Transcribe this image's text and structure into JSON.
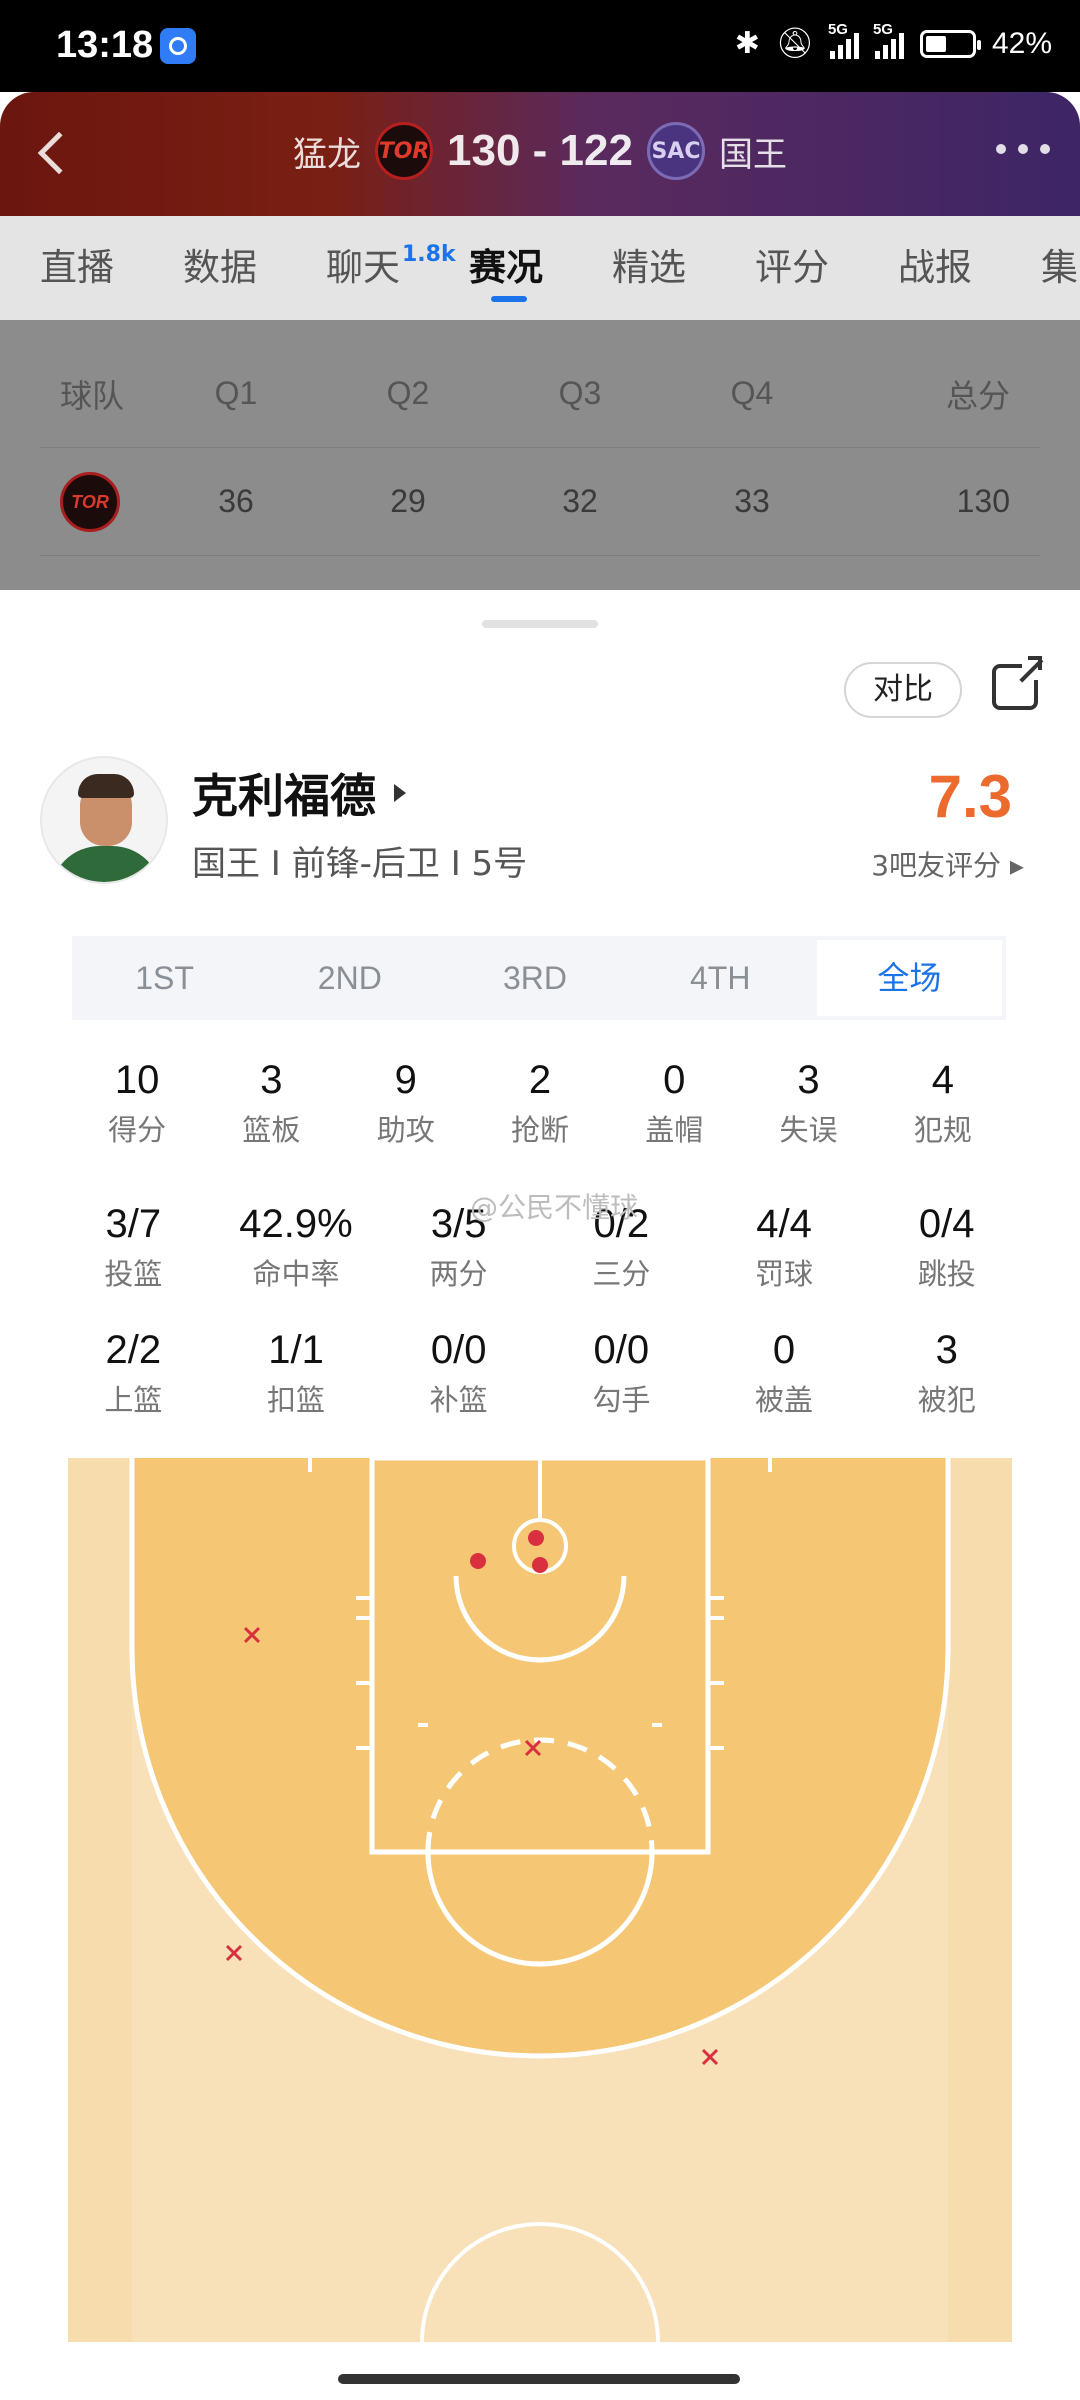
{
  "status_bar": {
    "time": "13:18",
    "signal1": "5G",
    "signal2": "5G",
    "battery": "42%"
  },
  "header": {
    "home_team": "猛龙",
    "home_abbr": "TOR",
    "score": "130 - 122",
    "away_abbr": "SAC",
    "away_team": "国王"
  },
  "tabs": [
    {
      "label": "直播"
    },
    {
      "label": "数据"
    },
    {
      "label": "聊天",
      "badge": "1.8k"
    },
    {
      "label": "赛况"
    },
    {
      "label": "精选"
    },
    {
      "label": "评分"
    },
    {
      "label": "战报"
    },
    {
      "label": "集"
    }
  ],
  "quarter_table": {
    "headers": [
      "球队",
      "Q1",
      "Q2",
      "Q3",
      "Q4",
      "总分"
    ],
    "row": {
      "team_abbr": "TOR",
      "values": [
        "36",
        "29",
        "32",
        "33",
        "130"
      ]
    }
  },
  "player_sheet": {
    "compare_label": "对比",
    "name": "克利福德",
    "info": "国王 I 前锋-后卫 I 5号",
    "rating": "7.3",
    "rating_count": "3吧友评分 ▸",
    "period_tabs": [
      "1ST",
      "2ND",
      "3RD",
      "4TH",
      "全场"
    ],
    "active_period": "全场",
    "watermark": "@公民不懂球",
    "stats_main": [
      {
        "value": "10",
        "label": "得分"
      },
      {
        "value": "3",
        "label": "篮板"
      },
      {
        "value": "9",
        "label": "助攻"
      },
      {
        "value": "2",
        "label": "抢断"
      },
      {
        "value": "0",
        "label": "盖帽"
      },
      {
        "value": "3",
        "label": "失误"
      },
      {
        "value": "4",
        "label": "犯规"
      }
    ],
    "stats_shooting": [
      {
        "value": "3/7",
        "label": "投篮"
      },
      {
        "value": "42.9%",
        "label": "命中率"
      },
      {
        "value": "3/5",
        "label": "两分"
      },
      {
        "value": "0/2",
        "label": "三分"
      },
      {
        "value": "4/4",
        "label": "罚球"
      },
      {
        "value": "0/4",
        "label": "跳投"
      }
    ],
    "stats_misc": [
      {
        "value": "2/2",
        "label": "上篮"
      },
      {
        "value": "1/1",
        "label": "扣篮"
      },
      {
        "value": "0/0",
        "label": "补篮"
      },
      {
        "value": "0/0",
        "label": "勾手"
      },
      {
        "value": "0",
        "label": "被盖"
      },
      {
        "value": "3",
        "label": "被犯"
      }
    ]
  },
  "shot_chart": {
    "made_color": "#d9303f",
    "missed_color": "#d9303f",
    "made_count": 3,
    "missed_count": 4
  }
}
